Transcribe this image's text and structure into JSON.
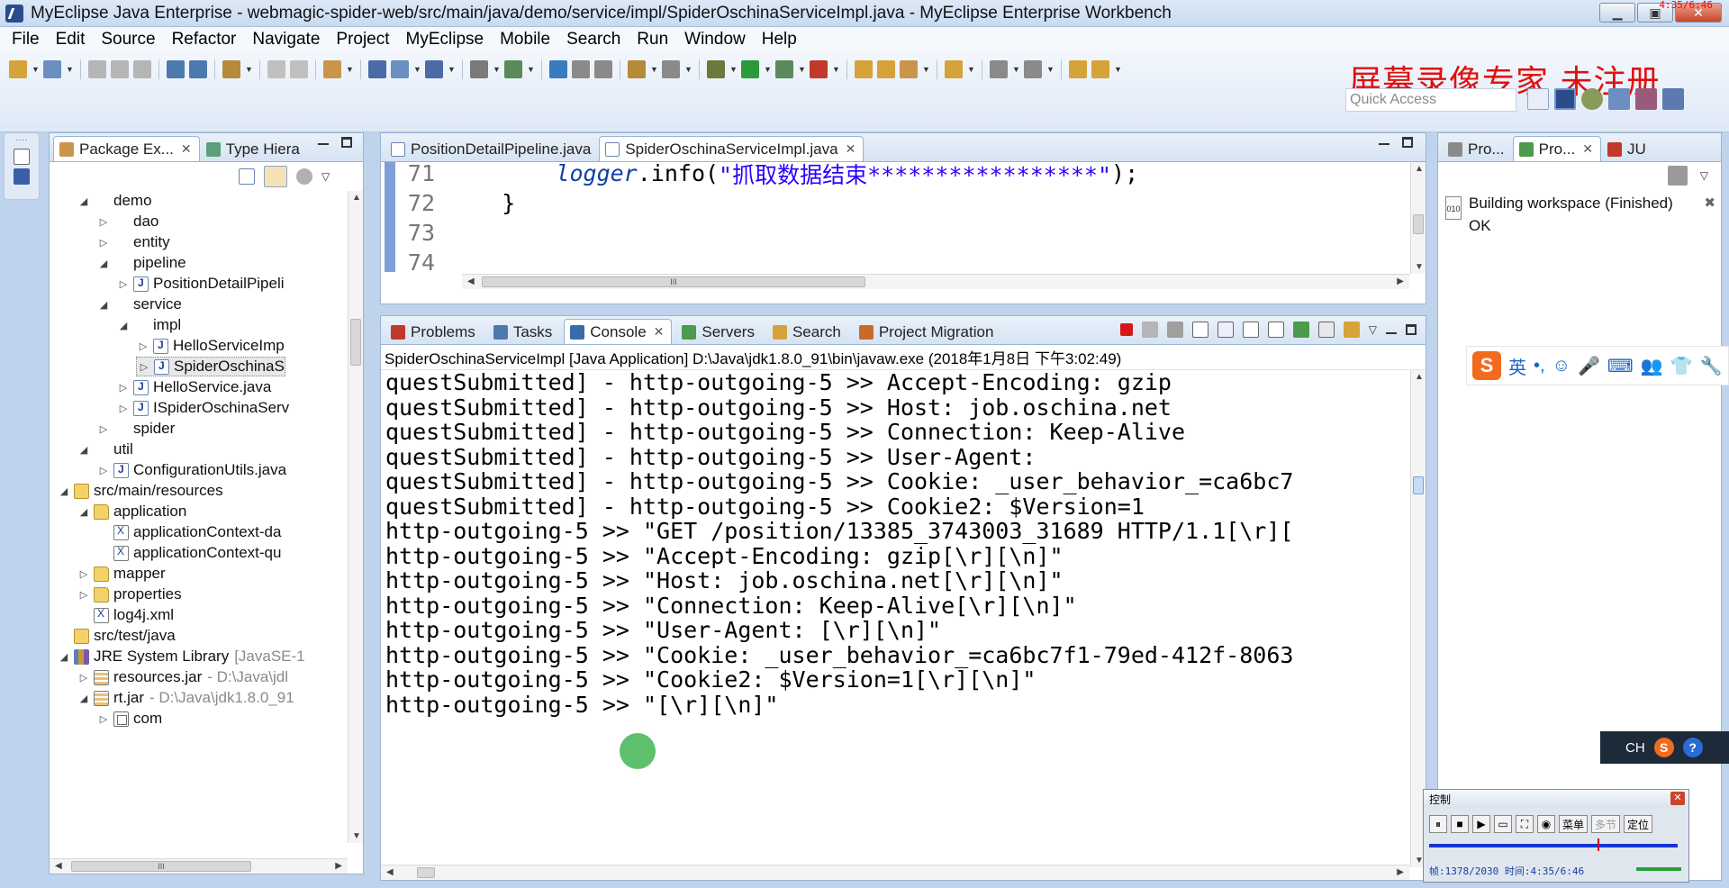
{
  "window": {
    "title": "MyEclipse Java Enterprise - webmagic-spider-web/src/main/java/demo/service/impl/SpiderOschinaServiceImpl.java - MyEclipse Enterprise Workbench",
    "recording_time": "4:35/6:46"
  },
  "menu": [
    "File",
    "Edit",
    "Source",
    "Refactor",
    "Navigate",
    "Project",
    "MyEclipse",
    "Mobile",
    "Search",
    "Run",
    "Window",
    "Help"
  ],
  "watermark": "屏幕录像专家  未注册",
  "quick_access": {
    "placeholder": "Quick Access"
  },
  "explorer": {
    "tabs": [
      {
        "label": "Package Ex...",
        "icon": "package-explorer-icon"
      },
      {
        "label": "Type Hiera",
        "icon": "type-hierarchy-icon"
      }
    ],
    "tree": [
      {
        "label": "demo",
        "depth": 2,
        "toggle": "expanded",
        "icon": "package"
      },
      {
        "label": "dao",
        "depth": 3,
        "toggle": "collapsed",
        "icon": "package"
      },
      {
        "label": "entity",
        "depth": 3,
        "toggle": "collapsed",
        "icon": "package"
      },
      {
        "label": "pipeline",
        "depth": 3,
        "toggle": "expanded",
        "icon": "package"
      },
      {
        "label": "PositionDetailPipeli",
        "depth": 4,
        "toggle": "collapsed",
        "icon": "java"
      },
      {
        "label": "service",
        "depth": 3,
        "toggle": "expanded",
        "icon": "package"
      },
      {
        "label": "impl",
        "depth": 4,
        "toggle": "expanded",
        "icon": "package"
      },
      {
        "label": "HelloServiceImp",
        "depth": 5,
        "toggle": "collapsed",
        "icon": "java"
      },
      {
        "label": "SpiderOschinaS",
        "depth": 5,
        "toggle": "collapsed",
        "icon": "java",
        "selected": true
      },
      {
        "label": "HelloService.java",
        "depth": 4,
        "toggle": "collapsed",
        "icon": "java"
      },
      {
        "label": "ISpiderOschinaServ",
        "depth": 4,
        "toggle": "collapsed",
        "icon": "java"
      },
      {
        "label": "spider",
        "depth": 3,
        "toggle": "collapsed",
        "icon": "package"
      },
      {
        "label": "util",
        "depth": 2,
        "toggle": "expanded",
        "icon": "package"
      },
      {
        "label": "ConfigurationUtils.java",
        "depth": 3,
        "toggle": "collapsed",
        "icon": "java"
      },
      {
        "label": "src/main/resources",
        "depth": 1,
        "toggle": "expanded",
        "icon": "srcfolder"
      },
      {
        "label": "application",
        "depth": 2,
        "toggle": "expanded",
        "icon": "folder"
      },
      {
        "label": "applicationContext-da",
        "depth": 3,
        "toggle": "none",
        "icon": "xml"
      },
      {
        "label": "applicationContext-qu",
        "depth": 3,
        "toggle": "none",
        "icon": "xml"
      },
      {
        "label": "mapper",
        "depth": 2,
        "toggle": "collapsed",
        "icon": "folder"
      },
      {
        "label": "properties",
        "depth": 2,
        "toggle": "collapsed",
        "icon": "folder"
      },
      {
        "label": "log4j.xml",
        "depth": 2,
        "toggle": "none",
        "icon": "xml"
      },
      {
        "label": "src/test/java",
        "depth": 1,
        "toggle": "none",
        "icon": "srcfolder"
      },
      {
        "label": "JRE System Library",
        "decoration": "[JavaSE-1",
        "depth": 1,
        "toggle": "expanded",
        "icon": "lib"
      },
      {
        "label": "resources.jar",
        "decoration": "- D:\\Java\\jdl",
        "depth": 2,
        "toggle": "collapsed",
        "icon": "jar"
      },
      {
        "label": "rt.jar",
        "decoration": "- D:\\Java\\jdk1.8.0_91",
        "depth": 2,
        "toggle": "expanded",
        "icon": "jar"
      },
      {
        "label": "com",
        "depth": 3,
        "toggle": "collapsed",
        "icon": "pkg2"
      }
    ],
    "hscroll_label": "III"
  },
  "editor": {
    "tabs": [
      {
        "label": "PositionDetailPipeline.java",
        "active": false
      },
      {
        "label": "SpiderOschinaServiceImpl.java",
        "active": true
      }
    ],
    "lines": [
      {
        "number": "71",
        "indent": "        ",
        "logger": "logger",
        "rest": ".info(",
        "string": "\"抓取数据结束*****************\"",
        "tail": ");"
      },
      {
        "number": "72",
        "indent": "    ",
        "logger": "",
        "rest": "}",
        "string": "",
        "tail": ""
      },
      {
        "number": "73",
        "indent": "",
        "logger": "",
        "rest": "",
        "string": "",
        "tail": ""
      },
      {
        "number": "74",
        "indent": "",
        "logger": "",
        "rest": "",
        "string": "",
        "tail": ""
      }
    ],
    "hscroll_label": "III"
  },
  "console": {
    "tabs": [
      {
        "label": "Problems",
        "active": false
      },
      {
        "label": "Tasks",
        "active": false
      },
      {
        "label": "Console",
        "active": true
      },
      {
        "label": "Servers",
        "active": false
      },
      {
        "label": "Search",
        "active": false
      },
      {
        "label": "Project Migration",
        "active": false
      }
    ],
    "header": "SpiderOschinaServiceImpl [Java Application] D:\\Java\\jdk1.8.0_91\\bin\\javaw.exe (2018年1月8日 下午3:02:49)",
    "lines": [
      "questSubmitted] - http-outgoing-5 >> Accept-Encoding: gzip",
      "questSubmitted] - http-outgoing-5 >> Host: job.oschina.net",
      "questSubmitted] - http-outgoing-5 >> Connection: Keep-Alive",
      "questSubmitted] - http-outgoing-5 >> User-Agent:",
      "questSubmitted] - http-outgoing-5 >> Cookie: _user_behavior_=ca6bc7",
      "questSubmitted] - http-outgoing-5 >> Cookie2: $Version=1",
      "http-outgoing-5 >> \"GET /position/13385_3743003_31689 HTTP/1.1[\\r][",
      "http-outgoing-5 >> \"Accept-Encoding: gzip[\\r][\\n]\"",
      "http-outgoing-5 >> \"Host: job.oschina.net[\\r][\\n]\"",
      "http-outgoing-5 >> \"Connection: Keep-Alive[\\r][\\n]\"",
      "http-outgoing-5 >> \"User-Agent: [\\r][\\n]\"",
      "http-outgoing-5 >> \"Cookie: _user_behavior_=ca6bc7f1-79ed-412f-8063",
      "http-outgoing-5 >> \"Cookie2: $Version=1[\\r][\\n]\"",
      "http-outgoing-5 >> \"[\\r][\\n]\""
    ]
  },
  "right_panel": {
    "tabs": [
      {
        "label": "Pro...",
        "active": false
      },
      {
        "label": "Pro...",
        "active": true
      },
      {
        "label": "JU",
        "active": false
      }
    ],
    "progress_text": "Building workspace (Finished)",
    "progress_status": "OK",
    "progress_icon_text": "010"
  },
  "ime": {
    "logo": "S",
    "mode": "英",
    "punct": "•,",
    "items": [
      "☺",
      "🎤",
      "⌨",
      "👥",
      "👕",
      "🔧"
    ]
  },
  "langbar": {
    "lang": "CH",
    "logo": "S",
    "help": "?"
  },
  "recorder": {
    "title": "控制",
    "menu_button": "菜单",
    "multi_button": "多节",
    "locate_button": "定位",
    "status": "帧:1378/2030 时间:4:35/6:46",
    "progress_fraction": 0.678
  },
  "colors": {
    "accent": "#7fa0d6",
    "string": "#2a00ff",
    "logger": "#0b3fa5",
    "watermark": "#e01010"
  }
}
